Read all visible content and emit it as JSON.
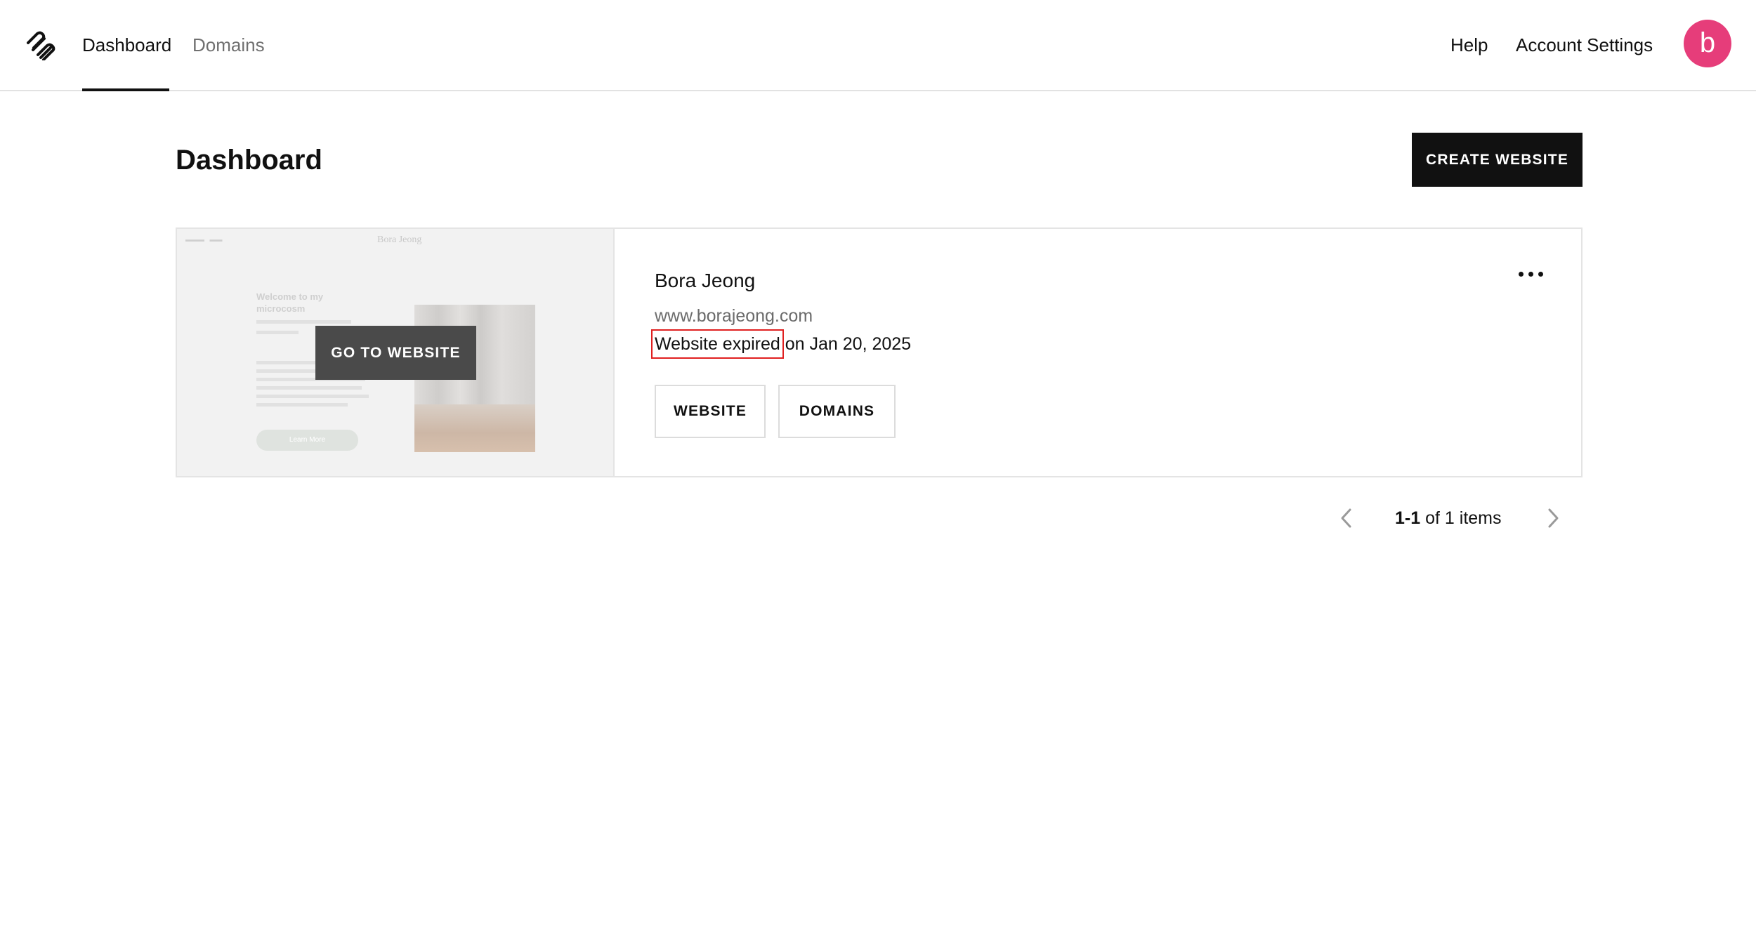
{
  "nav": {
    "logo_icon": "squarespace-logo-icon",
    "items": [
      {
        "label": "Dashboard",
        "active": true
      },
      {
        "label": "Domains",
        "active": false
      }
    ],
    "help_label": "Help",
    "account_label": "Account Settings",
    "avatar_initial": "b",
    "avatar_color": "#e63d7a"
  },
  "header": {
    "title": "Dashboard",
    "create_label": "CREATE WEBSITE"
  },
  "site": {
    "thumbnail": {
      "site_title": "Bora Jeong",
      "heading": "Welcome to my microcosm",
      "button_label": "Learn More"
    },
    "goto_label": "GO TO WEBSITE",
    "name": "Bora Jeong",
    "url": "www.borajeong.com",
    "status": "Website expired",
    "status_suffix": "on Jan 20, 2025",
    "more_icon": "more-horizontal-icon",
    "actions": {
      "website_label": "WEBSITE",
      "domains_label": "DOMAINS"
    }
  },
  "pagination": {
    "range": "1-1",
    "of_label": "of",
    "total": "1",
    "items_label": "items",
    "prev_icon": "chevron-left-icon",
    "next_icon": "chevron-right-icon"
  }
}
